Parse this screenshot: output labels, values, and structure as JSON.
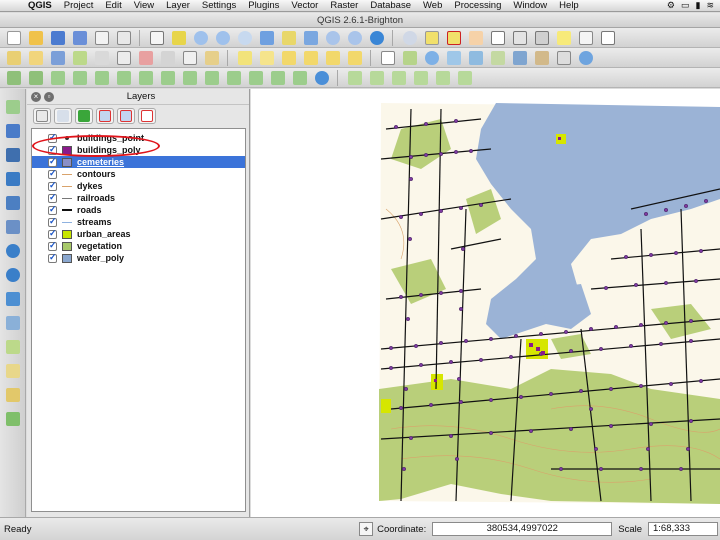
{
  "menubar": {
    "app_name": "QGIS",
    "items": [
      "Project",
      "Edit",
      "View",
      "Layer",
      "Settings",
      "Plugins",
      "Vector",
      "Raster",
      "Database",
      "Web",
      "Processing",
      "Window",
      "Help"
    ]
  },
  "window": {
    "title": "QGIS 2.6.1-Brighton"
  },
  "layers_panel": {
    "title": "Layers",
    "layers": [
      {
        "name": "buildings_point",
        "checked": true,
        "symbol": "point",
        "color": "#333333"
      },
      {
        "name": "buildings_poly",
        "checked": true,
        "symbol": "polygon",
        "color": "#8b1a8b"
      },
      {
        "name": "cemeteries",
        "checked": true,
        "symbol": "polygon",
        "color": "#8a8fc7",
        "selected": true
      },
      {
        "name": "contours",
        "checked": true,
        "symbol": "line",
        "color": "#d9a36b"
      },
      {
        "name": "dykes",
        "checked": true,
        "symbol": "line",
        "color": "#d9a36b"
      },
      {
        "name": "railroads",
        "checked": true,
        "symbol": "line",
        "color": "#777777"
      },
      {
        "name": "roads",
        "checked": true,
        "symbol": "line",
        "color": "#111111"
      },
      {
        "name": "streams",
        "checked": true,
        "symbol": "line",
        "color": "#8fb2e0"
      },
      {
        "name": "urban_areas",
        "checked": true,
        "symbol": "polygon",
        "color": "#c8e600"
      },
      {
        "name": "vegetation",
        "checked": true,
        "symbol": "polygon",
        "color": "#a8c96a"
      },
      {
        "name": "water_poly",
        "checked": true,
        "symbol": "polygon",
        "color": "#8aa7cf"
      }
    ]
  },
  "statusbar": {
    "status": "Ready",
    "coordinate_label": "Coordinate:",
    "coordinate_value": "380534,4997022",
    "scale_label": "Scale",
    "scale_value": "1:68,333"
  },
  "colors": {
    "water": "#9bb3d6",
    "vegetation": "#b9cf7a",
    "land": "#fbf7ea",
    "roads": "#111111",
    "buildings": "#7d3aa0",
    "selection": "#3b73d9",
    "highlight": "#e0141b"
  }
}
